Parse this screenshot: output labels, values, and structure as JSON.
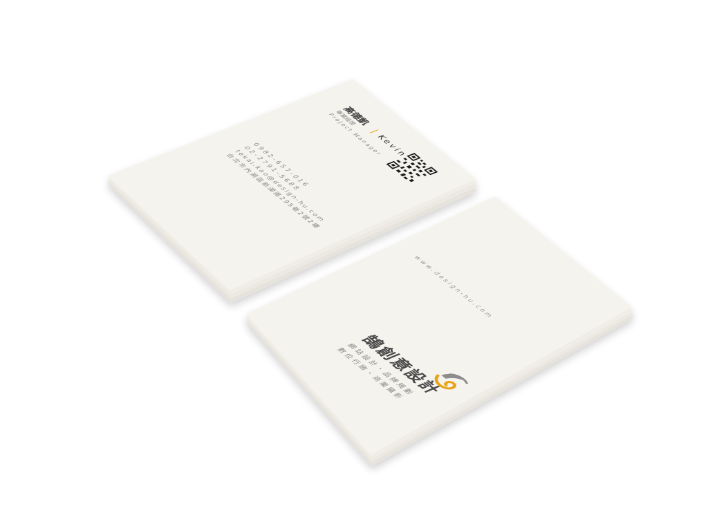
{
  "back_card": {
    "name_zh": "高德凱",
    "divider": "|",
    "name_en": "Kevin",
    "title_zh": "專案經理",
    "title_en": "Project Manager",
    "phone_mobile": "0982-657-016",
    "phone_office": "02-2791-5688",
    "email": "tekai.kao@design-hu.com",
    "address": "台北市內湖區新湖路295巷2號2樓",
    "qr_icon": "qr-code-icon"
  },
  "front_card": {
    "website": "www.design-hu.com",
    "company_name": "鵠創意設計",
    "tagline_1": "網站設計・品牌規劃",
    "tagline_2": "數位行銷・商業攝影",
    "logo_icon": "design-hu-logo-icon"
  },
  "colors": {
    "background": "#ffffff",
    "card": "#f5f3ee",
    "card_edge": "#e6e3dc",
    "text_dark": "#3d3d3d",
    "text_gray": "#8a8a8a",
    "accent": "#e8a417"
  }
}
